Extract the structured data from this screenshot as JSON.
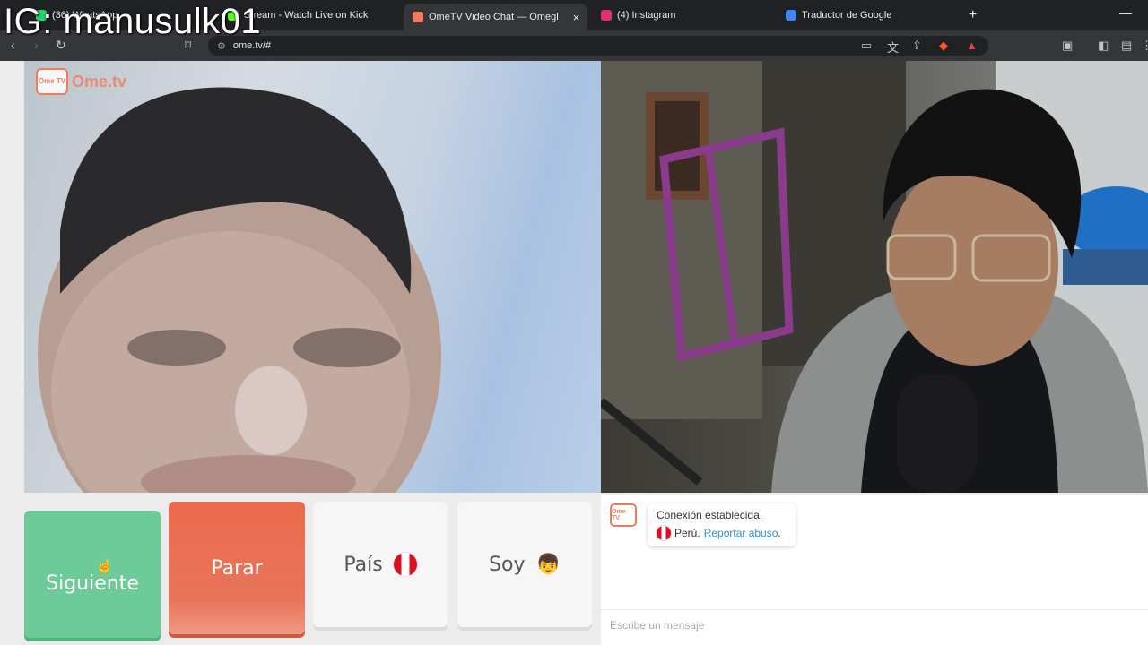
{
  "watermark": "IG: manusulk01",
  "tabs": [
    {
      "title": "(36) WhatsApp",
      "color": "#25d366"
    },
    {
      "title": "Stream - Watch Live on Kick",
      "color": "#53fc18"
    },
    {
      "title": "OmeTV Video Chat — Omegl",
      "color": "#f37a5b"
    },
    {
      "title": "(4) Instagram",
      "color": "#e1306c"
    },
    {
      "title": "Traductor de Google",
      "color": "#4285f4"
    }
  ],
  "browser": {
    "url": "ome.tv/#",
    "new_tab": "+",
    "minimize": "—",
    "close_tab": "×"
  },
  "video": {
    "logo_small": "Ome TV",
    "logo_brand": "Ome.tv"
  },
  "controls": {
    "next_label": "Siguiente",
    "stop_label": "Parar",
    "country_label": "País",
    "gender_label": "Soy",
    "gender_emoji": "👦"
  },
  "chat": {
    "logo_small": "Ome TV",
    "status": "Conexión establecida.",
    "country": "Perú.",
    "report_link": "Reportar abuso",
    "report_suffix": ".",
    "placeholder": "Escribe un mensaje"
  },
  "colors": {
    "next": "#6ccb98",
    "stop": "#eb6a4e",
    "brand": "#f37a5b"
  }
}
